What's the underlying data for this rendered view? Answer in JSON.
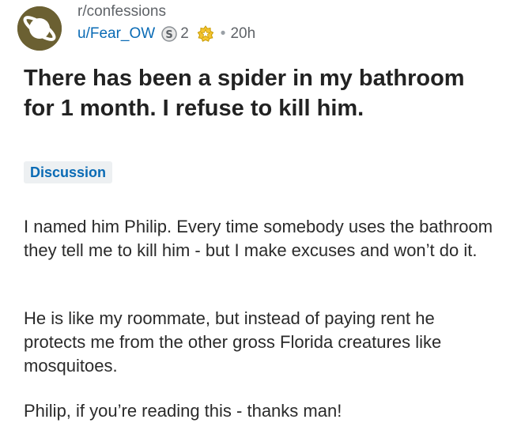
{
  "post": {
    "subreddit": "r/confessions",
    "author": "u/Fear_OW",
    "silver_award_count": "2",
    "separator": "•",
    "time": "20h",
    "title": "There has been a spider in my bathroom for 1 month. I refuse to kill him.",
    "flair": "Discussion",
    "body": [
      "I named him Philip. Every time somebody uses the bathroom they tell me to kill him - but I make excuses and won’t do it.",
      "He is like my roommate, but instead of paying rent he protects me from the other gross Florida creatures like mosquitoes.",
      "Philip, if you’re reading this - thanks man!"
    ]
  },
  "icons": {
    "avatar": "planet-icon",
    "silver_award": "silver-award-icon",
    "gold_award": "gold-award-icon"
  },
  "colors": {
    "link_blue": "#0a6bb5",
    "avatar_olive": "#6b6032",
    "gold": "#f4c430",
    "flair_bg": "#edf0f2"
  }
}
